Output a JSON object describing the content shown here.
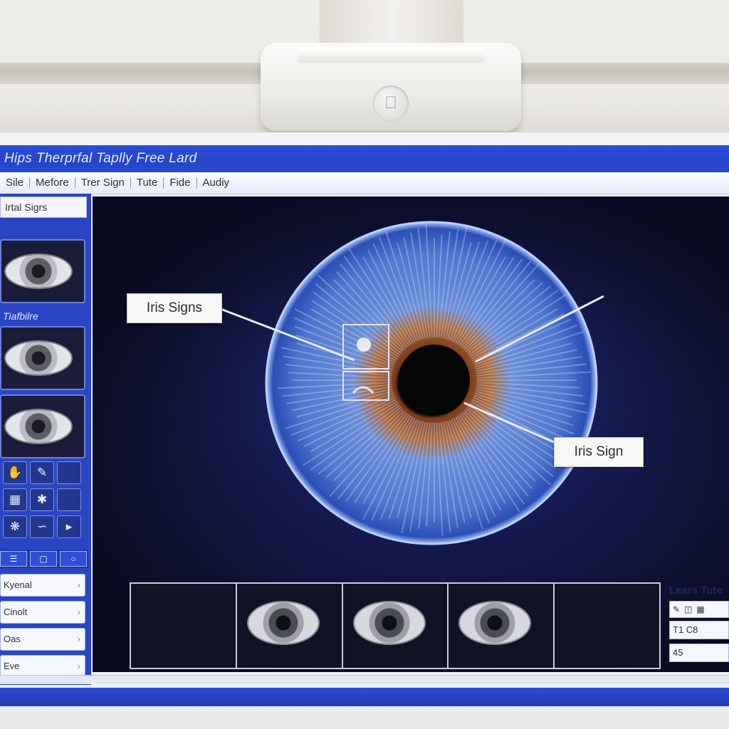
{
  "window": {
    "title": "Hips Therprfal Taplly Free Lard"
  },
  "menu": {
    "items": [
      "Sile",
      "Mefore",
      "Trer Sign",
      "Tute",
      "Fide",
      "Audiy"
    ]
  },
  "sidebar": {
    "tab_label": "Irtal Sigrs",
    "section_1": "",
    "section_2": "Tiafbilre",
    "fields": [
      {
        "label": "Kyenal"
      },
      {
        "label": "Cinolt"
      },
      {
        "label": "Oas"
      },
      {
        "label": "Eve"
      }
    ]
  },
  "viewer": {
    "callout_left": "Iris Signs",
    "callout_right": "Iris Sign"
  },
  "right_panel": {
    "title": "Lears Tute",
    "field_1": "T1 C8",
    "field_2": "45"
  },
  "colors": {
    "accent": "#2a45c4",
    "titlebar": "#2343c9",
    "iris_blue": "#5f8de0",
    "iris_ring": "#b06a36"
  }
}
